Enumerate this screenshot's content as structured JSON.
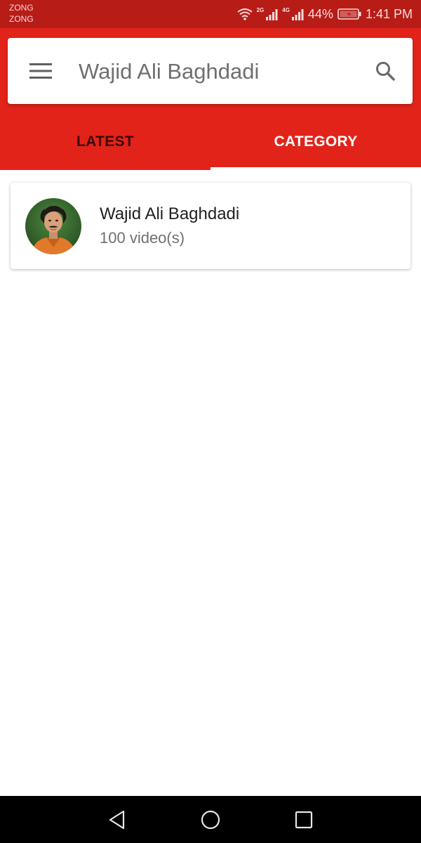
{
  "status_bar": {
    "carrier_1": "ZONG",
    "carrier_2": "ZONG",
    "network_1": "2G",
    "network_2": "4G",
    "battery": "44%",
    "time": "1:41 PM",
    "icons": [
      "wifi-icon",
      "signal-icon",
      "signal-icon",
      "battery-icon"
    ]
  },
  "header": {
    "menu_icon": "hamburger-menu-icon",
    "title": "Wajid Ali Baghdadi",
    "search_icon": "search-icon",
    "accent_color": "#e2231a"
  },
  "tabs": [
    {
      "label": "LATEST",
      "selected": false
    },
    {
      "label": "CATEGORY",
      "selected": true
    }
  ],
  "categories": [
    {
      "name": "Wajid Ali Baghdadi",
      "count": "100 video(s)",
      "avatar_icon": "avatar-photo"
    }
  ],
  "nav_bar": {
    "icons": [
      "back-icon",
      "home-icon",
      "recent-apps-icon"
    ]
  }
}
